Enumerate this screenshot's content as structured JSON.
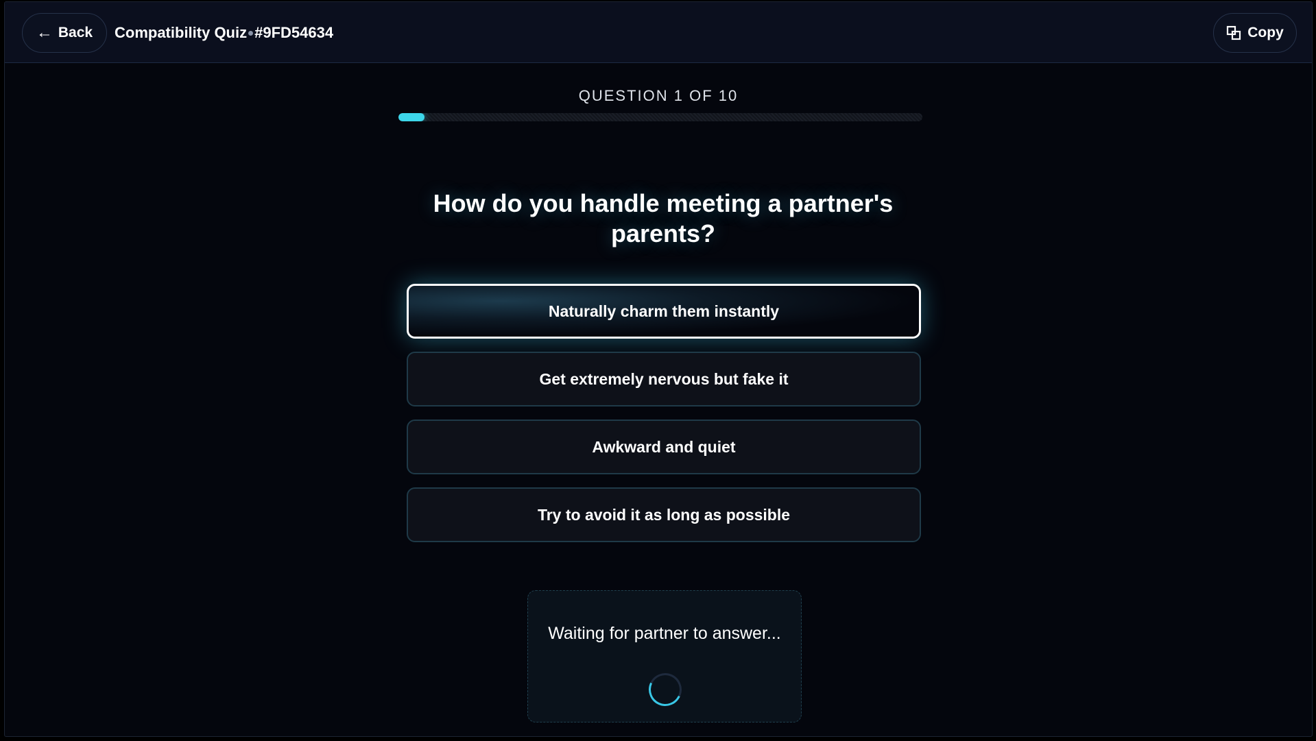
{
  "header": {
    "back_label": "Back",
    "back_icon": "arrow-left-icon",
    "quiz_name": "Compatibility Quiz",
    "quiz_code": "#9FD54634",
    "copy_label": "Copy",
    "copy_icon": "copy-icon"
  },
  "progress": {
    "label": "QUESTION 1 OF 10",
    "current": 1,
    "total": 10,
    "fill_percent": 5,
    "color": "#3dd6ea"
  },
  "question": {
    "text": "How do you handle meeting a partner's parents?"
  },
  "options": [
    {
      "label": "Naturally charm them instantly",
      "selected": true
    },
    {
      "label": "Get extremely nervous but fake it",
      "selected": false
    },
    {
      "label": "Awkward and quiet",
      "selected": false
    },
    {
      "label": "Try to avoid it as long as possible",
      "selected": false
    }
  ],
  "waiting": {
    "text": "Waiting for partner to answer...",
    "icon": "loading-spinner-icon"
  }
}
